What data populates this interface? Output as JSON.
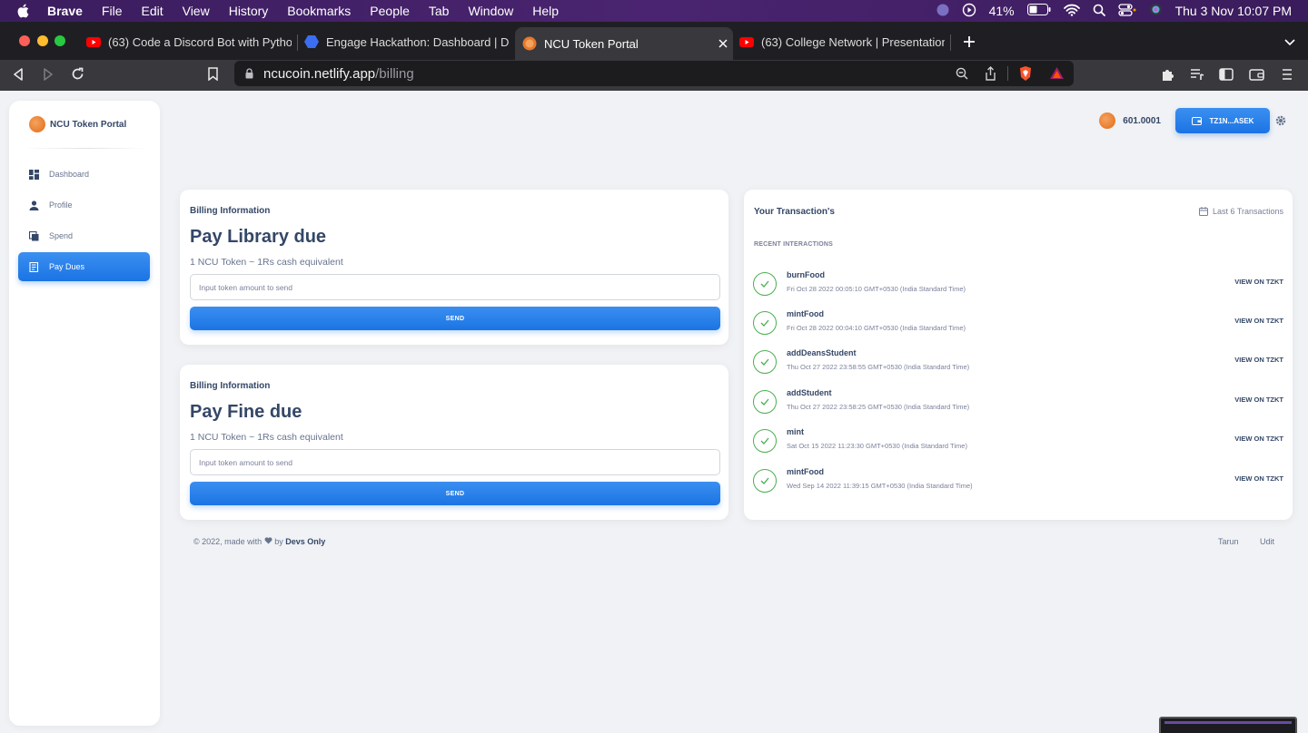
{
  "os_menubar": {
    "app_name": "Brave",
    "menus": [
      "File",
      "Edit",
      "View",
      "History",
      "Bookmarks",
      "People",
      "Tab",
      "Window",
      "Help"
    ],
    "battery": "41%",
    "datetime": "Thu 3 Nov  10:07 PM"
  },
  "browser": {
    "tabs": [
      {
        "title": "(63) Code a Discord Bot with Pytho",
        "icon": "youtube-icon",
        "active": false
      },
      {
        "title": "Engage Hackathon: Dashboard | De",
        "icon": "devpost-icon",
        "active": false
      },
      {
        "title": "NCU Token Portal",
        "icon": "coin-icon",
        "active": true
      },
      {
        "title": "(63) College Network | Presentation",
        "icon": "youtube-icon",
        "active": false
      }
    ],
    "url_host": "ncucoin.netlify.app",
    "url_path": "/billing"
  },
  "sidebar": {
    "brand": "NCU Token Portal",
    "items": [
      {
        "label": "Dashboard",
        "icon": "dashboard-icon",
        "active": false
      },
      {
        "label": "Profile",
        "icon": "person-icon",
        "active": false
      },
      {
        "label": "Spend",
        "icon": "spend-icon",
        "active": false
      },
      {
        "label": "Pay Dues",
        "icon": "receipt-icon",
        "active": true
      }
    ]
  },
  "header": {
    "balance": "601.0001",
    "wallet_label": "TZ1N...ASEK"
  },
  "billing": [
    {
      "label": "Billing Information",
      "title": "Pay Library due",
      "subtitle": "1 NCU Token ~ 1Rs cash equivalent",
      "placeholder": "Input token amount to send",
      "button": "SEND"
    },
    {
      "label": "Billing Information",
      "title": "Pay Fine due",
      "subtitle": "1 NCU Token ~ 1Rs cash equivalent",
      "placeholder": "Input token amount to send",
      "button": "SEND"
    }
  ],
  "transactions": {
    "title": "Your Transaction's",
    "filter": "Last 6 Transactions",
    "section_label": "RECENT INTERACTIONS",
    "view_label": "VIEW ON TZKT",
    "items": [
      {
        "name": "burnFood",
        "time": "Fri Oct 28 2022 00:05:10 GMT+0530 (India Standard Time)"
      },
      {
        "name": "mintFood",
        "time": "Fri Oct 28 2022 00:04:10 GMT+0530 (India Standard Time)"
      },
      {
        "name": "addDeansStudent",
        "time": "Thu Oct 27 2022 23:58:55 GMT+0530 (India Standard Time)"
      },
      {
        "name": "addStudent",
        "time": "Thu Oct 27 2022 23:58:25 GMT+0530 (India Standard Time)"
      },
      {
        "name": "mint",
        "time": "Sat Oct 15 2022 11:23:30 GMT+0530 (India Standard Time)"
      },
      {
        "name": "mintFood",
        "time": "Wed Sep 14 2022 11:39:15 GMT+0530 (India Standard Time)"
      }
    ]
  },
  "footer": {
    "prefix": "© 2022, made with",
    "middle": "by",
    "team": "Devs Only",
    "links": [
      "Tarun",
      "Udit"
    ]
  },
  "colors": {
    "accent": "#1A73E8",
    "success": "#4CAF50",
    "text": "#344767"
  }
}
